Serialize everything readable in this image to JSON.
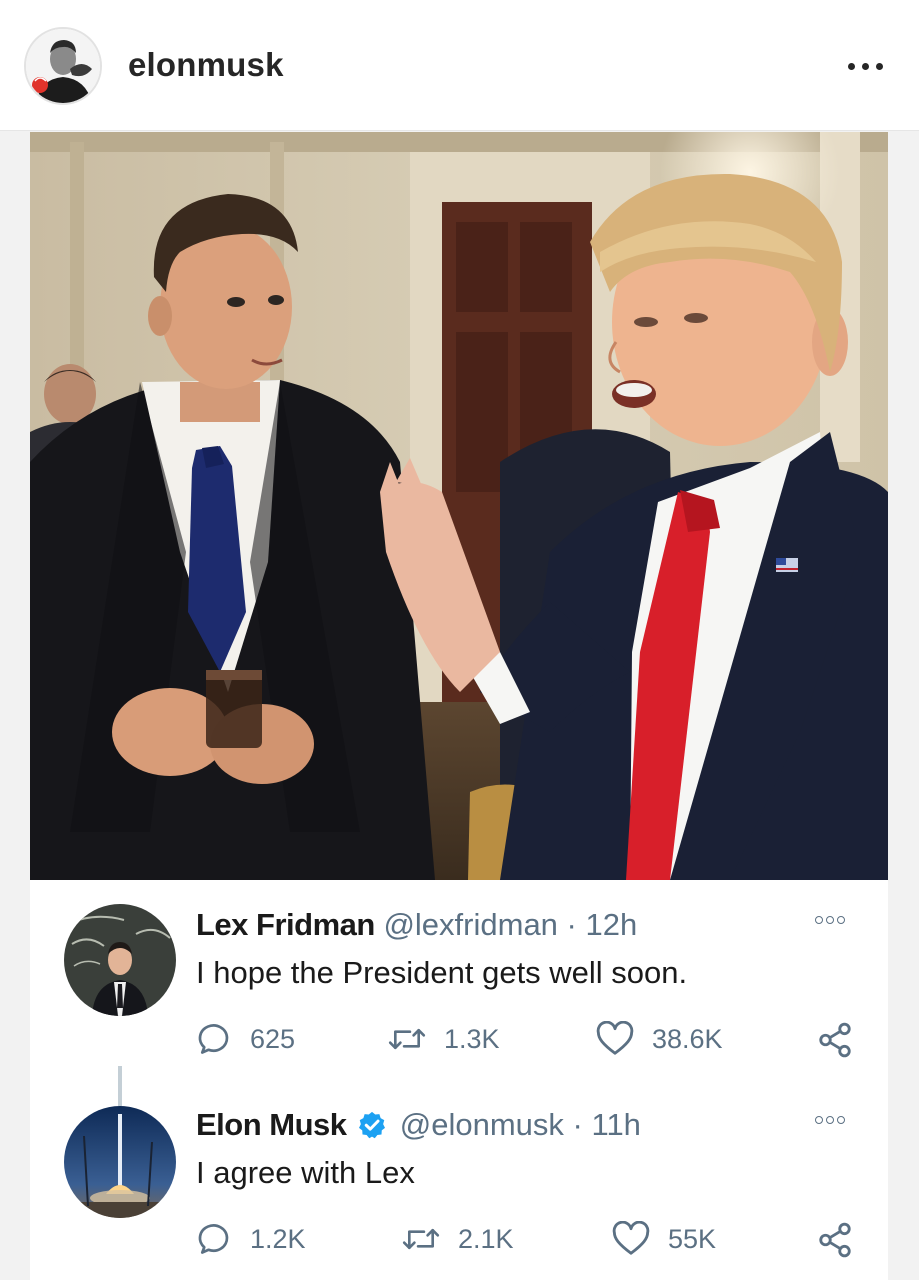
{
  "instagram": {
    "username": "elonmusk"
  },
  "tweets": [
    {
      "name": "Lex Fridman",
      "handle": "@lexfridman",
      "separator": "·",
      "time": "12h",
      "text": "I hope the President gets well soon.",
      "replies": "625",
      "retweets": "1.3K",
      "likes": "38.6K",
      "verified": false
    },
    {
      "name": "Elon Musk",
      "handle": "@elonmusk",
      "separator": "·",
      "time": "11h",
      "text": "I agree with Lex",
      "replies": "1.2K",
      "retweets": "2.1K",
      "likes": "55K",
      "verified": true
    }
  ],
  "colors": {
    "verified_blue": "#1da1f2",
    "secondary_text": "#5b7083",
    "red_tie": "#d81f2a",
    "navy_tie": "#1d2b6e"
  }
}
